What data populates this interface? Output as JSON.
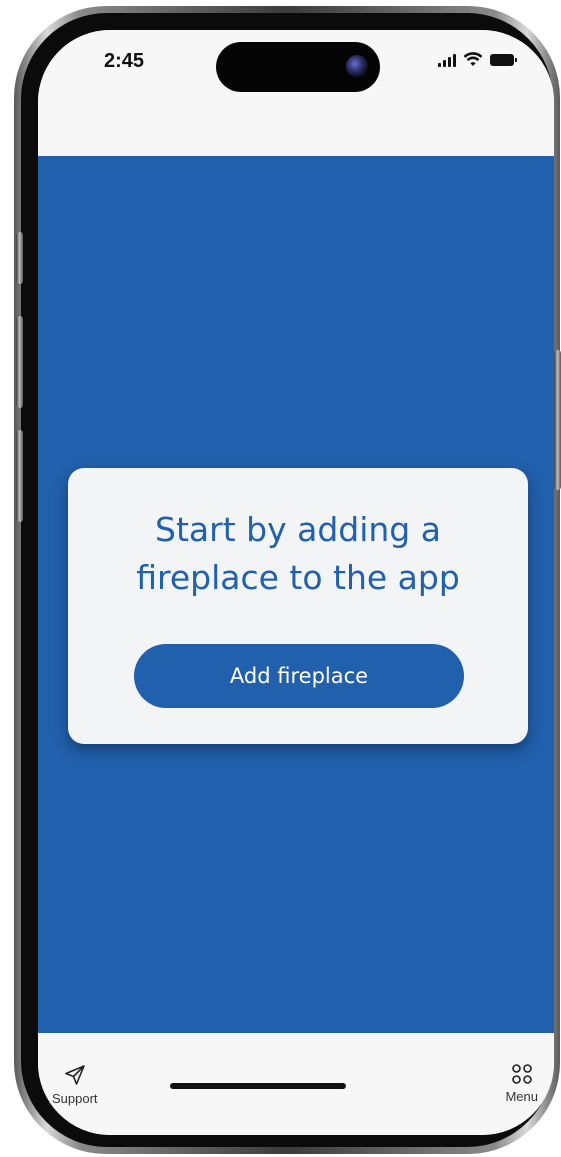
{
  "status_bar": {
    "time": "2:45",
    "signal_icon": "signal-bars-icon",
    "wifi_icon": "wifi-icon",
    "battery_icon": "battery-icon"
  },
  "main": {
    "background_color": "#2160ad",
    "card": {
      "title": "Start by adding a fireplace to the app",
      "button_label": "Add fireplace"
    }
  },
  "tab_bar": {
    "items": [
      {
        "label": "Support",
        "icon": "send-icon"
      },
      {
        "label": "Menu",
        "icon": "grid-icon"
      }
    ]
  },
  "colors": {
    "accent": "#2160ad",
    "card_background": "#f3f4f6",
    "bar_background": "#f7f7f7"
  }
}
